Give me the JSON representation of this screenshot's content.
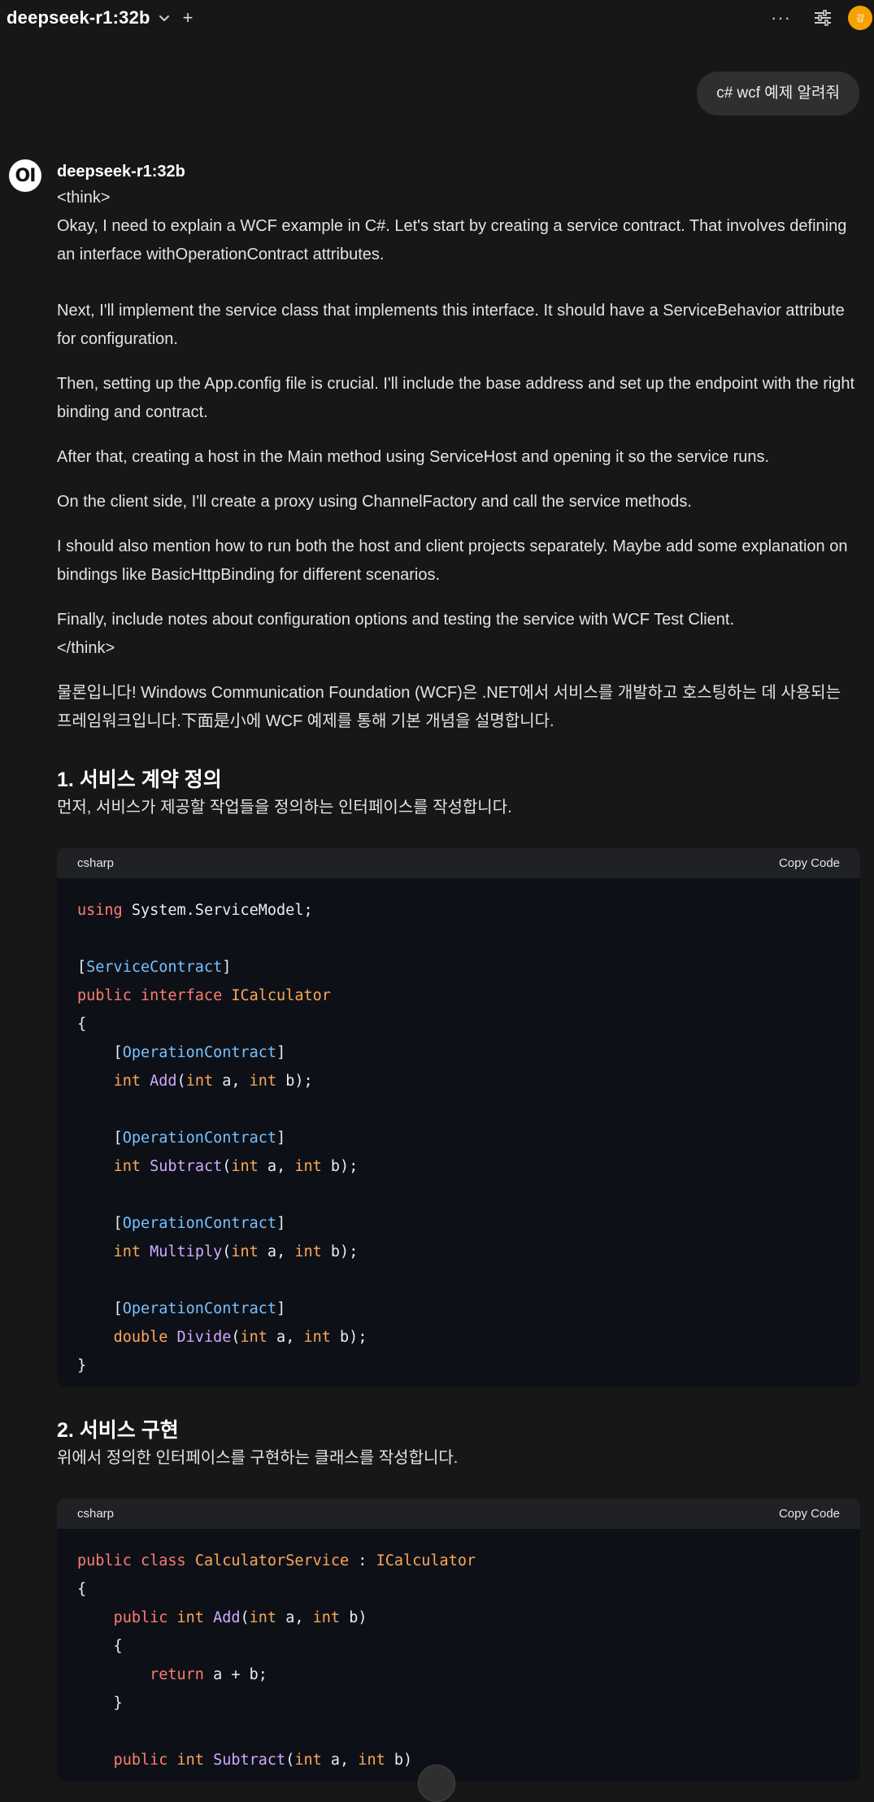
{
  "header": {
    "model_name": "deepseek-r1:32b",
    "new_chat_symbol": "+",
    "more_symbol": "···",
    "user_initial": "강",
    "avatar_color": "#f5a300"
  },
  "user_message": "c# wcf 예제 알려줘",
  "assistant": {
    "name": "deepseek-r1:32b",
    "logo_text": "OI",
    "think_open": "<think>",
    "think_paragraphs": [
      "Okay, I need to explain a WCF example in C#. Let's start by creating a service contract. That involves defining an interface withOperationContract attributes.",
      "Next, I'll implement the service class that implements this interface. It should have a ServiceBehavior attribute for configuration.",
      "Then, setting up the App.config file is crucial. I'll include the base address and set up the endpoint with the right binding and contract.",
      "After that, creating a host in the Main method using ServiceHost and opening it so the service runs.",
      "On the client side, I'll create a proxy using ChannelFactory and call the service methods.",
      "I should also mention how to run both the host and client projects separately. Maybe add some explanation on bindings like BasicHttpBinding for different scenarios.",
      "Finally, include notes about configuration options and testing the service with WCF Test Client."
    ],
    "think_close": "</think>",
    "intro": "물론입니다! Windows Communication Foundation (WCF)은 .NET에서 서비스를 개발하고 호스팅하는 데 사용되는 프레임워크입니다.下面是小에 WCF 예제를 통해 기본 개념을 설명합니다.",
    "sections": [
      {
        "heading": "1. 서비스 계약 정의",
        "description": "먼저, 서비스가 제공할 작업들을 정의하는 인터페이스를 작성합니다.",
        "code_lang": "csharp",
        "copy_label": "Copy Code"
      },
      {
        "heading": "2. 서비스 구현",
        "description": "위에서 정의한 인터페이스를 구현하는 클래스를 작성합니다.",
        "code_lang": "csharp",
        "copy_label": "Copy Code"
      }
    ]
  },
  "code_blocks": [
    {
      "lines": [
        [
          [
            "kw",
            "using"
          ],
          [
            "t",
            " System.ServiceModel;"
          ]
        ],
        [],
        [
          [
            "t",
            "["
          ],
          [
            "at",
            "ServiceContract"
          ],
          [
            "t",
            "]"
          ]
        ],
        [
          [
            "kw",
            "public"
          ],
          [
            "t",
            " "
          ],
          [
            "kw",
            "interface"
          ],
          [
            "t",
            " "
          ],
          [
            "ty",
            "ICalculator"
          ]
        ],
        [
          [
            "t",
            "{"
          ]
        ],
        [
          [
            "t",
            "    ["
          ],
          [
            "at",
            "OperationContract"
          ],
          [
            "t",
            "]"
          ]
        ],
        [
          [
            "t",
            "    "
          ],
          [
            "ty",
            "int"
          ],
          [
            "t",
            " "
          ],
          [
            "fn",
            "Add"
          ],
          [
            "t",
            "("
          ],
          [
            "ty",
            "int"
          ],
          [
            "t",
            " a, "
          ],
          [
            "ty",
            "int"
          ],
          [
            "t",
            " b);"
          ]
        ],
        [],
        [
          [
            "t",
            "    ["
          ],
          [
            "at",
            "OperationContract"
          ],
          [
            "t",
            "]"
          ]
        ],
        [
          [
            "t",
            "    "
          ],
          [
            "ty",
            "int"
          ],
          [
            "t",
            " "
          ],
          [
            "fn",
            "Subtract"
          ],
          [
            "t",
            "("
          ],
          [
            "ty",
            "int"
          ],
          [
            "t",
            " a, "
          ],
          [
            "ty",
            "int"
          ],
          [
            "t",
            " b);"
          ]
        ],
        [],
        [
          [
            "t",
            "    ["
          ],
          [
            "at",
            "OperationContract"
          ],
          [
            "t",
            "]"
          ]
        ],
        [
          [
            "t",
            "    "
          ],
          [
            "ty",
            "int"
          ],
          [
            "t",
            " "
          ],
          [
            "fn",
            "Multiply"
          ],
          [
            "t",
            "("
          ],
          [
            "ty",
            "int"
          ],
          [
            "t",
            " a, "
          ],
          [
            "ty",
            "int"
          ],
          [
            "t",
            " b);"
          ]
        ],
        [],
        [
          [
            "t",
            "    ["
          ],
          [
            "at",
            "OperationContract"
          ],
          [
            "t",
            "]"
          ]
        ],
        [
          [
            "t",
            "    "
          ],
          [
            "ty",
            "double"
          ],
          [
            "t",
            " "
          ],
          [
            "fn",
            "Divide"
          ],
          [
            "t",
            "("
          ],
          [
            "ty",
            "int"
          ],
          [
            "t",
            " a, "
          ],
          [
            "ty",
            "int"
          ],
          [
            "t",
            " b);"
          ]
        ],
        [
          [
            "t",
            "}"
          ]
        ]
      ]
    },
    {
      "lines": [
        [
          [
            "kw",
            "public"
          ],
          [
            "t",
            " "
          ],
          [
            "kw",
            "class"
          ],
          [
            "t",
            " "
          ],
          [
            "ty",
            "CalculatorService"
          ],
          [
            "t",
            " : "
          ],
          [
            "ty",
            "ICalculator"
          ]
        ],
        [
          [
            "t",
            "{"
          ]
        ],
        [
          [
            "t",
            "    "
          ],
          [
            "kw",
            "public"
          ],
          [
            "t",
            " "
          ],
          [
            "ty",
            "int"
          ],
          [
            "t",
            " "
          ],
          [
            "fn",
            "Add"
          ],
          [
            "t",
            "("
          ],
          [
            "ty",
            "int"
          ],
          [
            "t",
            " a, "
          ],
          [
            "ty",
            "int"
          ],
          [
            "t",
            " b)"
          ]
        ],
        [
          [
            "t",
            "    {"
          ]
        ],
        [
          [
            "t",
            "        "
          ],
          [
            "kw",
            "return"
          ],
          [
            "t",
            " a + b;"
          ]
        ],
        [
          [
            "t",
            "    }"
          ]
        ],
        [],
        [
          [
            "t",
            "    "
          ],
          [
            "kw",
            "public"
          ],
          [
            "t",
            " "
          ],
          [
            "ty",
            "int"
          ],
          [
            "t",
            " "
          ],
          [
            "fn",
            "Subtract"
          ],
          [
            "t",
            "("
          ],
          [
            "ty",
            "int"
          ],
          [
            "t",
            " a, "
          ],
          [
            "ty",
            "int"
          ],
          [
            "t",
            " b)"
          ]
        ]
      ]
    }
  ]
}
